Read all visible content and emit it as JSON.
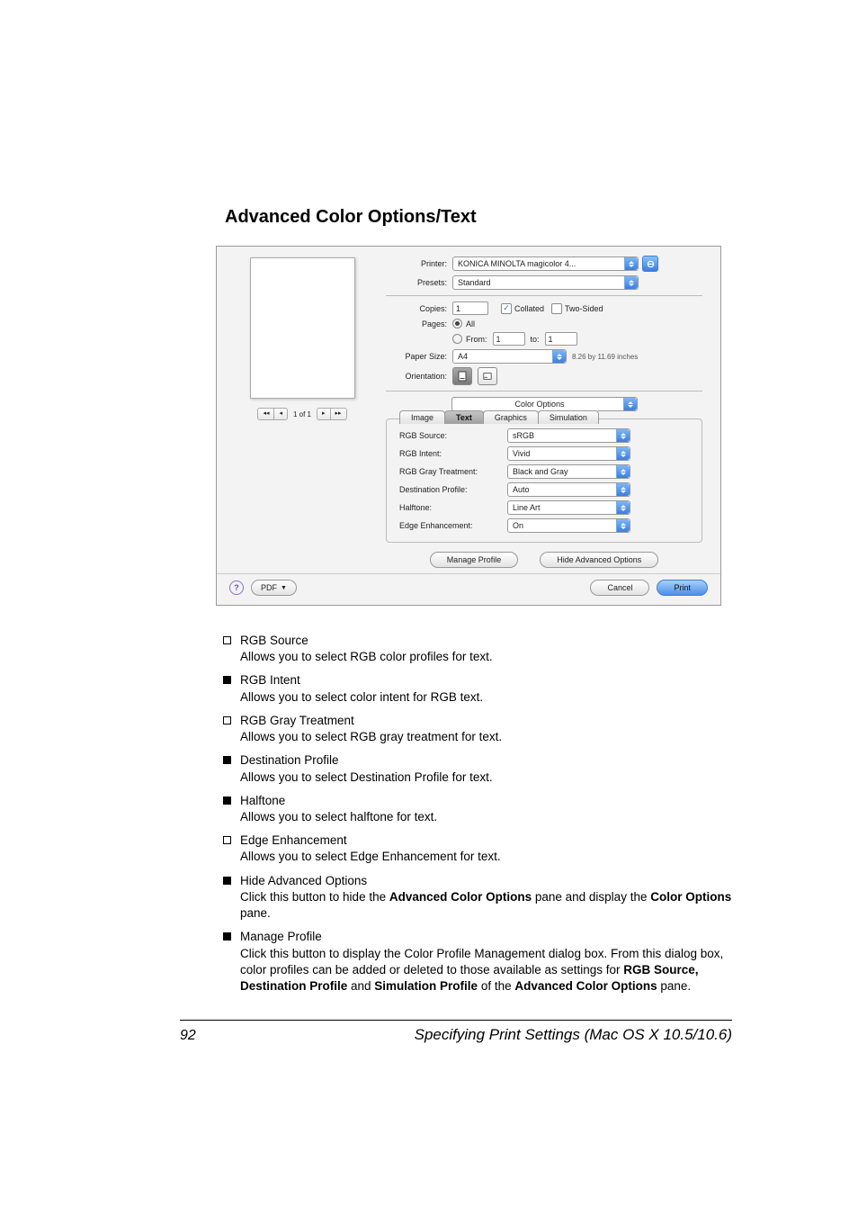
{
  "heading": "Advanced Color Options/Text",
  "dialog": {
    "printer_lbl": "Printer:",
    "printer_val": "KONICA MINOLTA magicolor 4...",
    "presets_lbl": "Presets:",
    "presets_val": "Standard",
    "copies_lbl": "Copies:",
    "copies_val": "1",
    "collated_lbl": "Collated",
    "twosided_lbl": "Two-Sided",
    "pages_lbl": "Pages:",
    "pages_all": "All",
    "pages_from_lbl": "From:",
    "pages_from_val": "1",
    "pages_to_lbl": "to:",
    "pages_to_val": "1",
    "papersize_lbl": "Paper Size:",
    "papersize_val": "A4",
    "papersize_hint": "8.26 by 11.69 inches",
    "orientation_lbl": "Orientation:",
    "section_select": "Color Options",
    "tabs": {
      "image": "Image",
      "text": "Text",
      "graphics": "Graphics",
      "simulation": "Simulation"
    },
    "opts": {
      "rgb_source": {
        "lbl": "RGB Source:",
        "val": "sRGB"
      },
      "rgb_intent": {
        "lbl": "RGB Intent:",
        "val": "Vivid"
      },
      "rgb_gray": {
        "lbl": "RGB Gray Treatment:",
        "val": "Black and Gray"
      },
      "dest_profile": {
        "lbl": "Destination Profile:",
        "val": "Auto"
      },
      "halftone": {
        "lbl": "Halftone:",
        "val": "Line Art"
      },
      "edge": {
        "lbl": "Edge Enhancement:",
        "val": "On"
      }
    },
    "manage_profile_btn": "Manage Profile",
    "hide_adv_btn": "Hide Advanced Options",
    "pdf_btn": "PDF",
    "cancel_btn": "Cancel",
    "print_btn": "Print",
    "pager_text": "1 of 1"
  },
  "items": [
    {
      "bullet": "outline",
      "title": "RGB Source",
      "text": "Allows you to select RGB color profiles for text."
    },
    {
      "bullet": "filled",
      "title": "RGB Intent",
      "text": "Allows you to select color intent for RGB text."
    },
    {
      "bullet": "outline",
      "title": "RGB Gray Treatment",
      "text": "Allows you to select RGB gray treatment for text."
    },
    {
      "bullet": "filled",
      "title": "Destination Profile",
      "text": "Allows you to select Destination Profile for text."
    },
    {
      "bullet": "filled",
      "title": "Halftone",
      "text": "Allows you to select halftone for text."
    },
    {
      "bullet": "outline",
      "title": "Edge Enhancement",
      "text": "Allows you to select Edge Enhancement for text."
    },
    {
      "bullet": "filled",
      "title": "Hide Advanced Options",
      "html": "Click this button to hide the <b>Advanced Color Options</b> pane and display the <b>Color Options</b> pane."
    },
    {
      "bullet": "filled",
      "title": "Manage Profile",
      "html": "Click this button to display the Color Profile Management dialog box. From this dialog box, color profiles can be added or deleted to those available as settings for <b>RGB Source, Destination Profile</b> and <b>Simulation Profile</b> of the <b>Advanced Color Options</b> pane."
    }
  ],
  "footer": {
    "num": "92",
    "text": "Specifying Print Settings (Mac OS X 10.5/10.6)"
  }
}
